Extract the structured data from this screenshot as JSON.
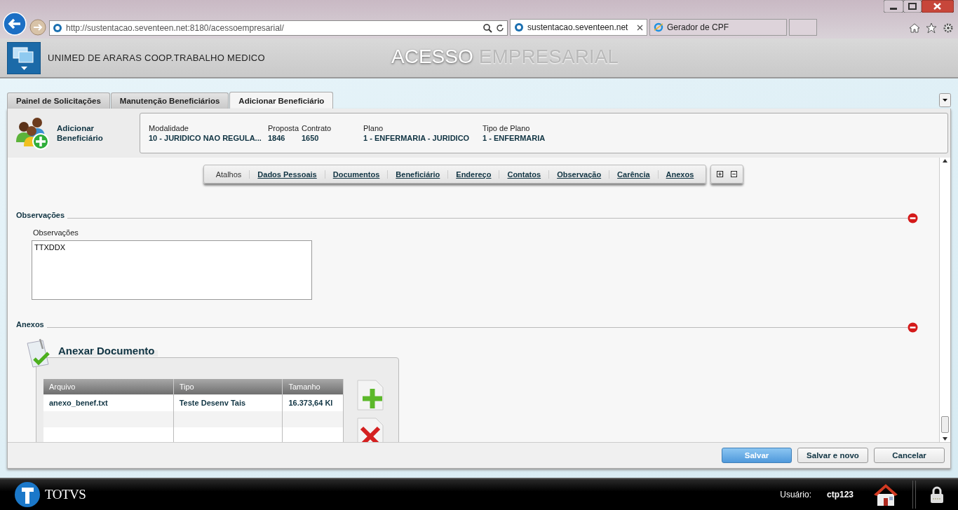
{
  "browser": {
    "url": "http://sustentacao.seventeen.net:8180/acessoempresarial/"
  },
  "browser_tabs": [
    {
      "title": "sustentacao.seventeen.net",
      "selected": true
    },
    {
      "title": "Gerador de CPF",
      "selected": false
    }
  ],
  "header": {
    "company": "UNIMED DE ARARAS COOP.TRABALHO MEDICO",
    "title_first": "ACESSO",
    "title_second": "EMPRESARIAL"
  },
  "tabs": [
    {
      "label": "Painel de Solicitações",
      "selected": false
    },
    {
      "label": "Manutenção Beneficiários",
      "selected": false
    },
    {
      "label": "Adicionar Beneficiário",
      "selected": true
    }
  ],
  "page": {
    "title": "Adicionar Beneficiário"
  },
  "summary": [
    {
      "label": "Modalidade",
      "value": "10 - JURIDICO NAO REGULA..."
    },
    {
      "label": "Proposta",
      "value": "1846"
    },
    {
      "label": "Contrato",
      "value": "1650"
    },
    {
      "label": "Plano",
      "value": "1 - ENFERMARIA - JURIDICO"
    },
    {
      "label": "Tipo de Plano",
      "value": "1 - ENFERMARIA"
    }
  ],
  "shortcuts": {
    "label": "Atalhos",
    "links": [
      "Dados Pessoais",
      "Documentos",
      "Beneficiário",
      "Endereço",
      "Contatos",
      "Observação",
      "Carência",
      "Anexos"
    ]
  },
  "sections": [
    {
      "kind": "notes",
      "title": "Observações",
      "expanded": true,
      "field_label": "Observações",
      "value": "TTXDDX"
    },
    {
      "kind": "attachments",
      "title": "Anexos",
      "expanded": true,
      "panel_title": "Anexar Documento",
      "columns": [
        "Arquivo",
        "Tipo",
        "Tamanho"
      ],
      "rows": [
        [
          "anexo_benef.txt",
          "Teste Desenv Tais",
          "16.373,64 Kl"
        ]
      ]
    }
  ],
  "buttons": [
    {
      "label": "Salvar",
      "primary": true
    },
    {
      "label": "Salvar e novo",
      "primary": false
    },
    {
      "label": "Cancelar",
      "primary": false
    }
  ],
  "taskbar": {
    "brand": "TOTVS",
    "user_label": "Usuário:",
    "user": "ctp123"
  }
}
